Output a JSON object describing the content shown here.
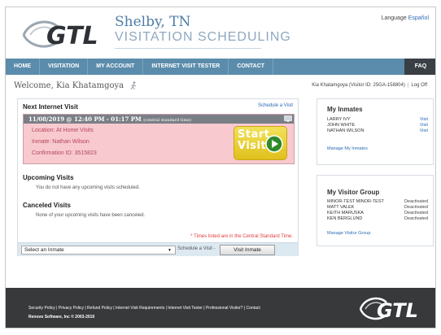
{
  "header": {
    "city": "Shelby, TN",
    "subtitle": "VISITATION SCHEDULING",
    "language_label": "Language",
    "language_link": "Español",
    "logo_text": "GTL"
  },
  "nav": {
    "items": [
      "HOME",
      "VISITATION",
      "MY ACCOUNT",
      "INTERNET VISIT TESTER",
      "CONTACT"
    ],
    "faq": "FAQ"
  },
  "welcome": "Welcome, Kia Khatamgoya",
  "account": {
    "visitor_id": "Kia Khatamgoya (Visitor ID: 25GA-158804)",
    "separator": "|",
    "logoff": "Log Off"
  },
  "next_visit": {
    "title": "Next Internet Visit",
    "schedule_link": "Schedule a Visit",
    "datetime": "11/08/2019 @ 12:40 PM - 01:17 PM",
    "timezone_note": "(central standard time)",
    "location": "Location: At Home Visits",
    "inmate": "Inmate: Nathan Wilson",
    "confirmation": "Confirmation ID: 3515823",
    "start_line1": "Start",
    "start_line2": "Visit"
  },
  "upcoming": {
    "title": "Upcoming Visits",
    "message": "You do not have any upcoming visits scheduled."
  },
  "canceled": {
    "title": "Canceled Visits",
    "message": "None of your upcoming visits have been canceled."
  },
  "tz_note": "* Times listed are in the Central Standard Time.",
  "bottom": {
    "select_value": "Select an Inmate",
    "schedule_label": "Schedule a Visit -",
    "visit_button": "Visit Inmate"
  },
  "my_inmates": {
    "title": "My Inmates",
    "rows": [
      {
        "name": "LARRY IVY",
        "action": "Visit"
      },
      {
        "name": "JOHN WHITE",
        "action": "Visit"
      },
      {
        "name": "NATHAN WILSON",
        "action": "Visit"
      }
    ],
    "manage": "Manage My Inmates"
  },
  "visitor_group": {
    "title": "My Visitor Group",
    "rows": [
      {
        "name": "MINOR-TEST MINOR-TEST",
        "status": "Deactivated"
      },
      {
        "name": "MATT VALEK",
        "status": "Deactivated"
      },
      {
        "name": "KEITH MARUSKA",
        "status": "Deactivated"
      },
      {
        "name": "KEN BERGLUND",
        "status": "Deactivated"
      }
    ],
    "manage": "Manage Visitor Group"
  },
  "footer": {
    "links": "Security Policy | Privacy Policy | Refund Policy | Internet Visit Requirements | Internet Visit Tester | Professional Visitor? | Contact",
    "copyright": "Renovo Software, Inc © 2003-2019",
    "logo_text": "GTL"
  },
  "colors": {
    "nav": "#5b8cab",
    "faq": "#3a3f45",
    "visit_card": "#f9c9d0",
    "start_button": "#f2e25a",
    "footer": "#38393b",
    "link": "#2a6bb5"
  }
}
